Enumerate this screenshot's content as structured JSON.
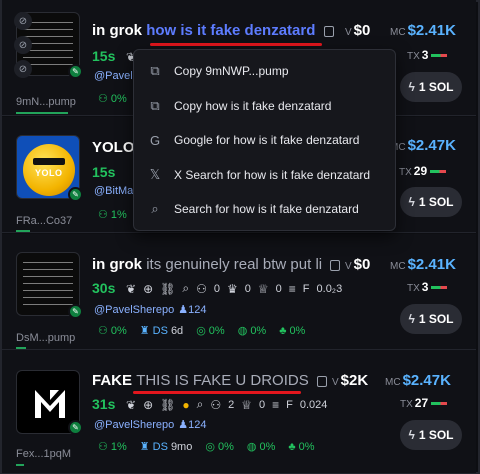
{
  "rows": [
    {
      "address": "9mN...pump",
      "name": "in grok",
      "description": "how is it fake denzatard",
      "volume": "$0",
      "market_cap": "$2.41K",
      "age": "15s",
      "holders_partial": "0",
      "tx_count": "3",
      "user": "@PavelS",
      "metric_partial": "0%",
      "buy_label": "1 SOL"
    },
    {
      "address": "FRa...Co37",
      "name": "YOLO",
      "market_cap": "$2.47K",
      "age": "15s",
      "tx_count": "29",
      "user": "@BitMar",
      "metric_partial": "1%",
      "buy_label": "1 SOL"
    },
    {
      "address": "DsM...pump",
      "name": "in grok",
      "description": "its genuinely real btw put li",
      "volume": "$0",
      "market_cap": "$2.41K",
      "age": "30s",
      "holders": "0",
      "trophy": "0",
      "cup": "0",
      "fees": "0.0₂3",
      "tx_count": "3",
      "user": "@PavelSherepo",
      "followers": "124",
      "metrics": [
        "0%",
        "DS",
        "6d",
        "0%",
        "0%",
        "0%",
        "0%"
      ],
      "buy_label": "1 SOL"
    },
    {
      "address": "Fex...1pqM",
      "name": "FAKE",
      "description": "THIS IS FAKE U DROIDS",
      "volume": "$2K",
      "market_cap": "$2.47K",
      "age": "31s",
      "holders": "2",
      "cup": "0",
      "fees": "0.024",
      "tx_count": "27",
      "user": "@PavelSherepo",
      "followers": "124",
      "metrics": [
        "1%",
        "DS",
        "9mo",
        "0%",
        "0%",
        "0%"
      ],
      "buy_label": "1 SOL"
    }
  ],
  "labels": {
    "v": "V",
    "mc": "MC",
    "tx": "TX",
    "f": "F"
  },
  "context_menu": [
    {
      "icon": "copy-icon",
      "label": "Copy 9mNWP...pump"
    },
    {
      "icon": "copy-icon",
      "label": "Copy how is it fake denzatard"
    },
    {
      "icon": "google-icon",
      "label": "Google for how is it fake denzatard"
    },
    {
      "icon": "x-icon",
      "label": "X Search for how is it fake denzatard"
    },
    {
      "icon": "search-icon",
      "label": "Search for how is it fake denzatard"
    }
  ],
  "colors": {
    "accent_blue": "#5ab3ff",
    "green": "#22c25e",
    "underline_red": "#e3161d",
    "link_blue": "#5d7cff"
  }
}
